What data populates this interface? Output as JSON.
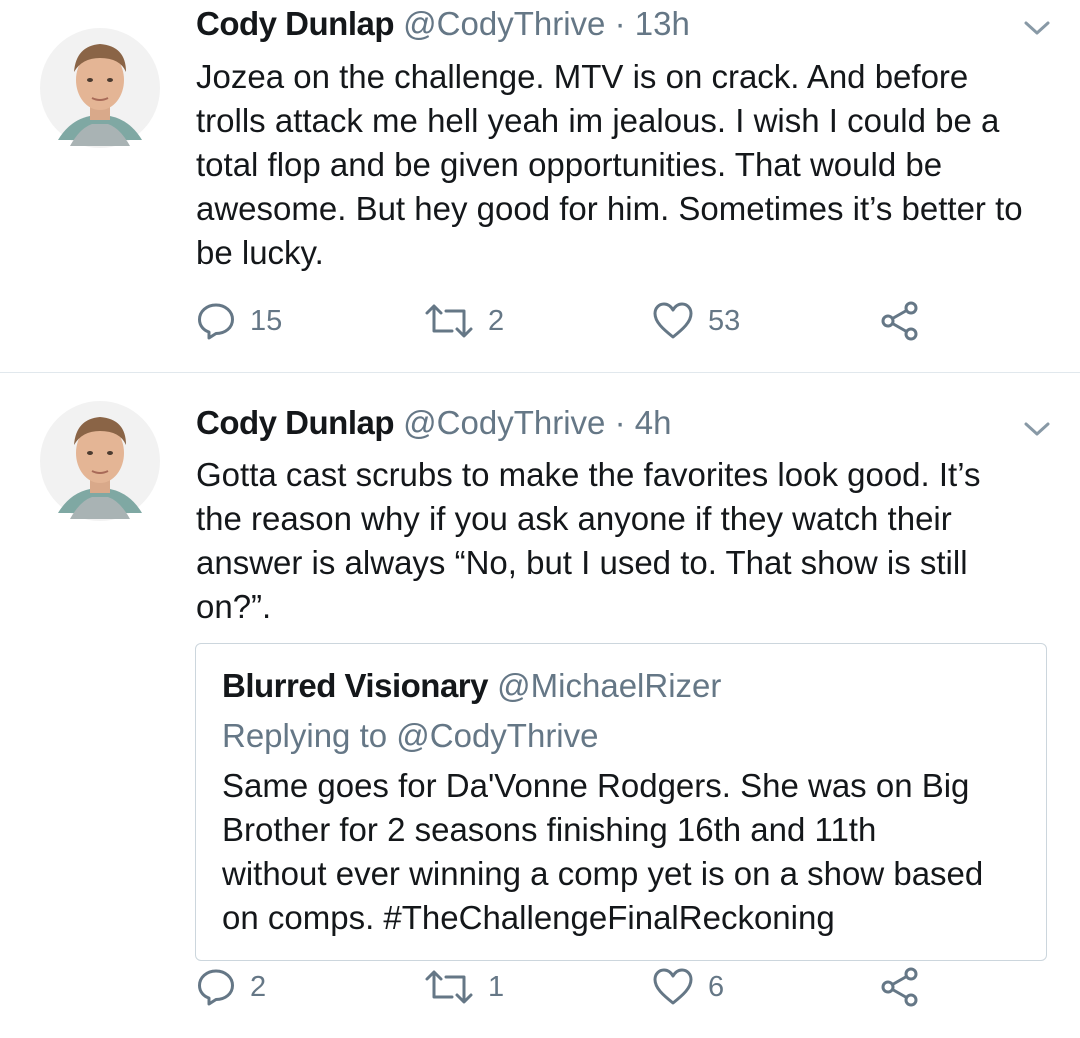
{
  "tweets": [
    {
      "name": "Cody Dunlap",
      "handle": "@CodyThrive",
      "separator": "·",
      "time": "13h",
      "text_lines": [
        "Jozea on the challenge. MTV is on crack. And before",
        "trolls attack me hell yeah im jealous. I wish I could be a",
        "total flop and be given opportunities. That would be",
        "awesome. But hey good for him. Sometimes it’s better to",
        "be lucky."
      ],
      "replies": "15",
      "retweets": "2",
      "likes": "53"
    },
    {
      "name": "Cody Dunlap",
      "handle": "@CodyThrive",
      "separator": "·",
      "time": "4h",
      "text_lines": [
        "Gotta cast scrubs to make the favorites look good. It’s",
        "the reason why if you ask anyone if they watch their",
        "answer is always “No, but I used to. That show is still",
        "on?”."
      ],
      "quote": {
        "name": "Blurred Visionary",
        "handle": "@MichaelRizer",
        "replying": "Replying to @CodyThrive",
        "text_lines": [
          "Same goes for Da'Vonne Rodgers. She was on Big",
          "Brother for 2 seasons finishing 16th and 11th",
          "without ever winning a comp yet is on a show based",
          "on comps. #TheChallengeFinalReckoning"
        ]
      },
      "replies": "2",
      "retweets": "1",
      "likes": "6"
    }
  ],
  "icons": {
    "reply": "reply-icon",
    "retweet": "retweet-icon",
    "like": "heart-icon",
    "share": "share-icon",
    "menu": "chevron-down-icon"
  },
  "colors": {
    "text": "#14171a",
    "secondary": "#657786",
    "border": "#ccd6dd",
    "divider": "#e1e8ed"
  }
}
